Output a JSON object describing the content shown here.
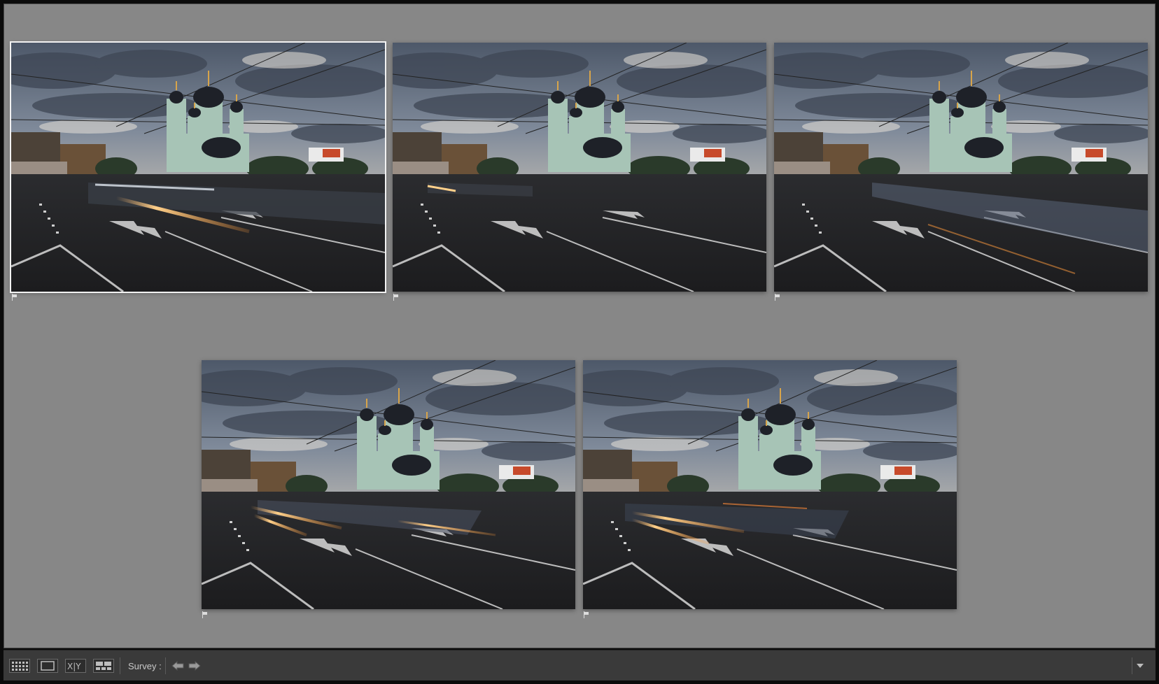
{
  "toolbar": {
    "survey_label": "Survey :",
    "view_modes": [
      "grid-view-icon",
      "loupe-view-icon",
      "compare-view-icon",
      "survey-view-icon"
    ],
    "compare_label": "X|Y",
    "nav": [
      "previous-arrow-icon",
      "next-arrow-icon"
    ],
    "menu_icon": "chevron-down-icon"
  },
  "photos": [
    {
      "id": "photo-1",
      "selected": true,
      "variant": "long-light-trail"
    },
    {
      "id": "photo-2",
      "selected": false,
      "variant": "short-trail"
    },
    {
      "id": "photo-3",
      "selected": false,
      "variant": "blue-blur"
    },
    {
      "id": "photo-4",
      "selected": false,
      "variant": "orange-trails"
    },
    {
      "id": "photo-5",
      "selected": false,
      "variant": "orange-trails-b"
    }
  ],
  "colors": {
    "background": "#878787",
    "toolbar": "#3a3a3a",
    "selection": "#f2f2f2",
    "toolbar_text": "#c9c9c9"
  }
}
